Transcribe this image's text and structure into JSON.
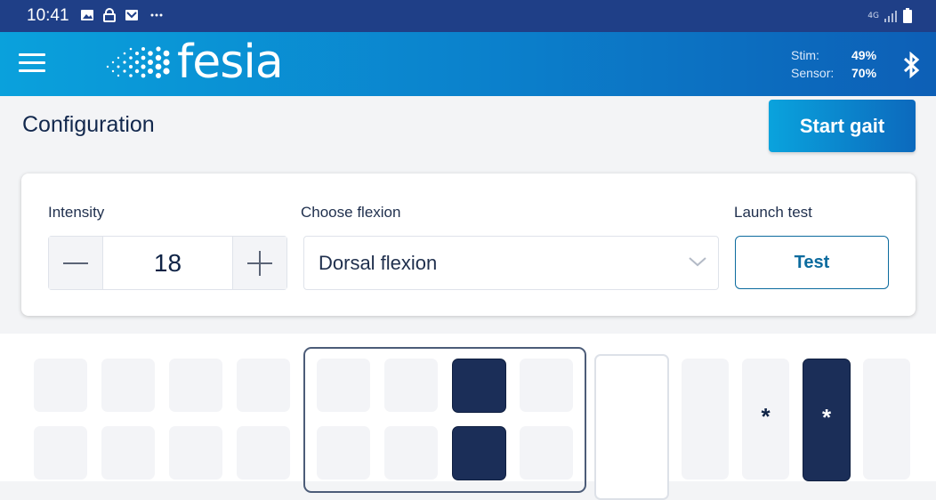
{
  "status_bar": {
    "time": "10:41",
    "icons": [
      "image-icon",
      "lock-icon",
      "mail-icon",
      "more-dots-icon"
    ],
    "network": "4G",
    "signal_icon": "signal-icon",
    "battery_icon": "battery-icon"
  },
  "header": {
    "brand": "fesia",
    "levels": [
      {
        "label": "Stim:",
        "value": "49%"
      },
      {
        "label": "Sensor:",
        "value": "70%"
      }
    ],
    "bluetooth_icon": "bluetooth-icon",
    "menu_icon": "hamburger-menu-icon"
  },
  "page": {
    "title": "Configuration",
    "start_button": "Start gait"
  },
  "config": {
    "intensity_label": "Intensity",
    "intensity_value": "18",
    "flexion_label": "Choose flexion",
    "flexion_value": "Dorsal flexion",
    "test_label": "Launch test",
    "test_button": "Test"
  },
  "electrodes": {
    "star_symbol": "*",
    "grid_top_row_active": [
      false,
      false,
      false,
      false,
      false,
      false,
      true,
      false
    ],
    "grid_bottom_row_active": [
      false,
      false,
      false,
      false,
      false,
      false,
      true,
      false
    ],
    "right_pads": [
      {
        "label": "",
        "active": false
      },
      {
        "label": "*",
        "active": false
      },
      {
        "label": "*",
        "active": true
      },
      {
        "label": "",
        "active": false
      }
    ]
  },
  "colors": {
    "status_bar": "#1f3f87",
    "header_start": "#0aa1dc",
    "header_end": "#0d5fb6",
    "active_pad": "#1b2e58",
    "inactive_pad": "#f3f4f7",
    "accent": "#0c6b9e"
  }
}
